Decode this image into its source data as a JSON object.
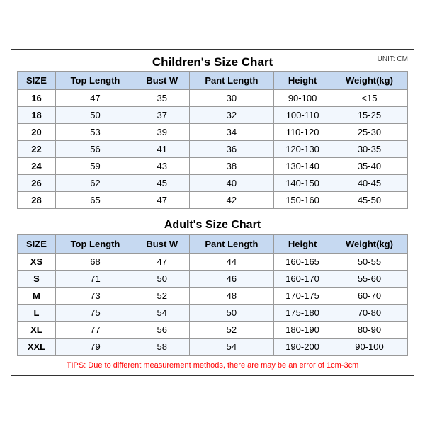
{
  "unit": "UNIT: CM",
  "children": {
    "title": "Children's Size Chart",
    "headers": [
      "SIZE",
      "Top Length",
      "Bust W",
      "Pant Length",
      "Height",
      "Weight(kg)"
    ],
    "rows": [
      [
        "16",
        "47",
        "35",
        "30",
        "90-100",
        "<15"
      ],
      [
        "18",
        "50",
        "37",
        "32",
        "100-110",
        "15-25"
      ],
      [
        "20",
        "53",
        "39",
        "34",
        "110-120",
        "25-30"
      ],
      [
        "22",
        "56",
        "41",
        "36",
        "120-130",
        "30-35"
      ],
      [
        "24",
        "59",
        "43",
        "38",
        "130-140",
        "35-40"
      ],
      [
        "26",
        "62",
        "45",
        "40",
        "140-150",
        "40-45"
      ],
      [
        "28",
        "65",
        "47",
        "42",
        "150-160",
        "45-50"
      ]
    ]
  },
  "adults": {
    "title": "Adult's Size Chart",
    "headers": [
      "SIZE",
      "Top Length",
      "Bust W",
      "Pant Length",
      "Height",
      "Weight(kg)"
    ],
    "rows": [
      [
        "XS",
        "68",
        "47",
        "44",
        "160-165",
        "50-55"
      ],
      [
        "S",
        "71",
        "50",
        "46",
        "160-170",
        "55-60"
      ],
      [
        "M",
        "73",
        "52",
        "48",
        "170-175",
        "60-70"
      ],
      [
        "L",
        "75",
        "54",
        "50",
        "175-180",
        "70-80"
      ],
      [
        "XL",
        "77",
        "56",
        "52",
        "180-190",
        "80-90"
      ],
      [
        "XXL",
        "79",
        "58",
        "54",
        "190-200",
        "90-100"
      ]
    ]
  },
  "tips": "TIPS: Due to different measurement methods, there are may be an error of 1cm-3cm"
}
